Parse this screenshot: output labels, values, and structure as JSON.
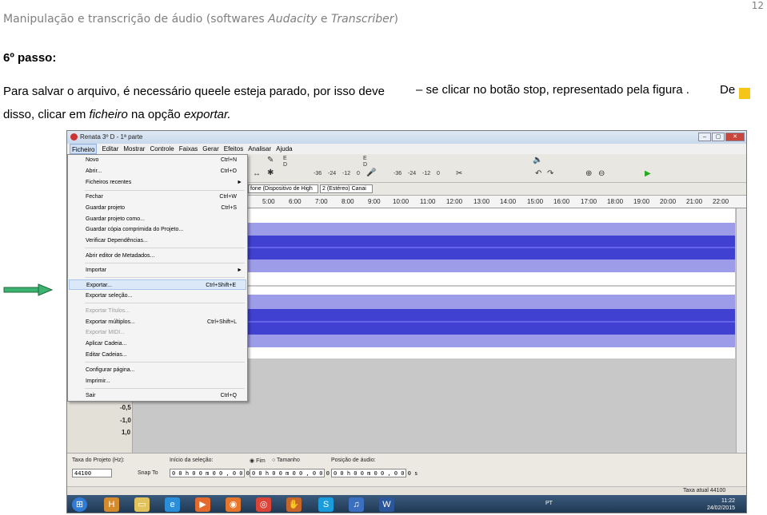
{
  "doc": {
    "header_prefix": "Manipulação e transcrição de áudio (softwares ",
    "header_app1": "Audacity",
    "header_mid": " e ",
    "header_app2": "Transcriber",
    "header_suffix": ")",
    "page_number": "12",
    "step_title": "6º passo:",
    "line1_a": "Para salvar o arquivo, é necessário queele esteja parado, por isso deve",
    "line1_b": "– se clicar no botão stop, representado pela figura .",
    "line1_c": "De",
    "line2_a": "disso, clicar em ",
    "line2_b": "ficheiro",
    "line2_c": " na opção ",
    "line2_d": "exportar."
  },
  "colors": {
    "accent_yellow": "#f5c518",
    "arrow_green": "#3cb371",
    "wave_blue": "#3333cc"
  },
  "app": {
    "title": "Renata 3º D - 1ª parte",
    "menus": [
      "Ficheiro",
      "Editar",
      "Mostrar",
      "Controle",
      "Faixas",
      "Gerar",
      "Efeitos",
      "Analisar",
      "Ajuda"
    ],
    "meter_labels": [
      "E",
      "D",
      "E",
      "D"
    ],
    "meter_scale": [
      "-36",
      "-24",
      "-12",
      "0",
      "-36",
      "-24",
      "-12",
      "0"
    ],
    "device_out": "fone (Dispositivo de High",
    "device_ch": "2 (Estéreo) Canai",
    "ruler": [
      "5:00",
      "6:00",
      "7:00",
      "8:00",
      "9:00",
      "10:00",
      "11:00",
      "12:00",
      "13:00",
      "14:00",
      "15:00",
      "16:00",
      "17:00",
      "18:00",
      "19:00",
      "20:00",
      "21:00",
      "22:00"
    ],
    "track_ctl_letters": [
      "E",
      "D"
    ],
    "scale": [
      "-0,5",
      "-1,0",
      "1,0"
    ]
  },
  "file_menu": [
    {
      "label": "Novo",
      "shortcut": "Ctrl+N"
    },
    {
      "label": "Abrir...",
      "shortcut": "Ctrl+O"
    },
    {
      "label": "Ficheiros recentes",
      "submenu": "►"
    },
    {
      "label": "Fechar",
      "shortcut": "Ctrl+W"
    },
    {
      "label": "Guardar projeto",
      "shortcut": "Ctrl+S"
    },
    {
      "label": "Guardar projeto como..."
    },
    {
      "label": "Guardar cópia comprimida do Projeto..."
    },
    {
      "label": "Verificar Dependências..."
    },
    {
      "label": "Abrir editor de Metadados..."
    },
    {
      "label": "Importar",
      "submenu": "►"
    },
    {
      "label": "Exportar...",
      "shortcut": "Ctrl+Shift+E"
    },
    {
      "label": "Exportar seleção..."
    },
    {
      "label": "Exportar Títulos..."
    },
    {
      "label": "Exportar múltiplos...",
      "shortcut": "Ctrl+Shift+L"
    },
    {
      "label": "Exportar MIDI..."
    },
    {
      "label": "Aplicar Cadeia..."
    },
    {
      "label": "Editar Cadeias..."
    },
    {
      "label": "Configurar página..."
    },
    {
      "label": "Imprimir..."
    },
    {
      "label": "Sair",
      "shortcut": "Ctrl+Q"
    }
  ],
  "bottom": {
    "rate_label": "Taxa do Projeto (Hz):",
    "rate_value": "44100",
    "snap_label": "Snap To",
    "sel_label": "Início da seleção:",
    "sel_value": "0 0 h 0 0 m 0 0 , 0 0 0  s",
    "end_label": "Fim",
    "len_label": "Tamanho",
    "end_value": "0 0 h 0 0 m 0 0 , 0 0 0  s",
    "pos_label": "Posição de áudio:",
    "pos_value": "0 0 h 0 0 m 0 0 , 0 0 0  s",
    "status": "Taxa atual 44100"
  },
  "taskbar": {
    "lang": "PT",
    "time": "11:22",
    "date": "24/02/2015"
  }
}
